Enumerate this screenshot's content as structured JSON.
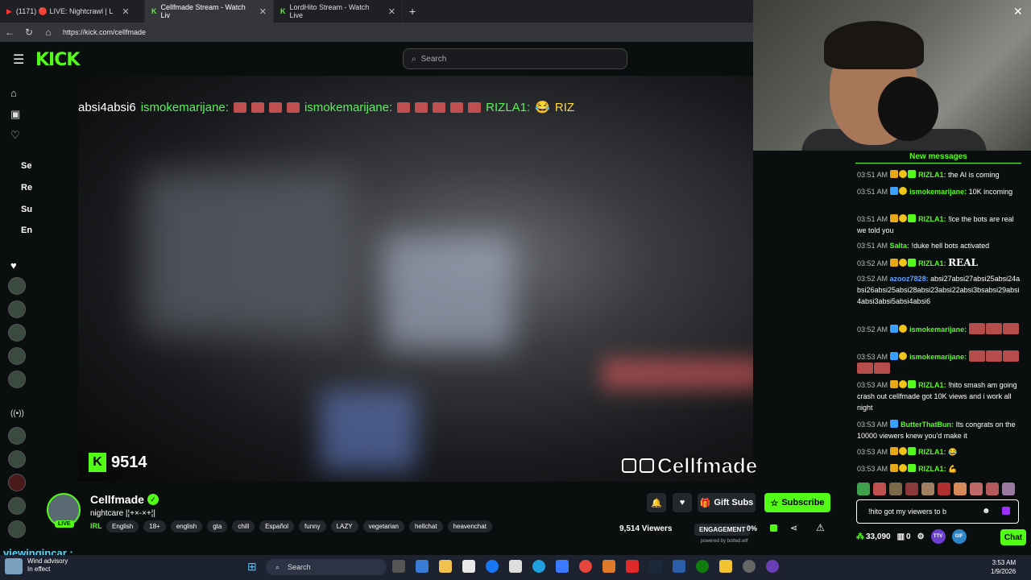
{
  "browser": {
    "tabs": [
      {
        "label": "(1171) 🔴 LIVE: Nightcrawl | L",
        "active": false
      },
      {
        "label": "Cellfmade Stream - Watch Liv",
        "active": true
      },
      {
        "label": "LordHito Stream - Watch Live",
        "active": false
      }
    ],
    "new_tab": "+",
    "url": "https://kick.com/cellfmade"
  },
  "kick": {
    "logo": "KICK",
    "search_placeholder": "Search",
    "sidebar_labels": [
      "Se",
      "Re",
      "Su",
      "En"
    ]
  },
  "video": {
    "overlay_chat": "absi4absi6",
    "overlay_user1": "ismokemarijane:",
    "overlay_user2": "ismokemarijane:",
    "overlay_user3": "RIZLA1:",
    "overlay_tail": "RIZ",
    "overlay_viewers": "9514",
    "overlay_brand": "Cellfmade"
  },
  "stream": {
    "channel": "Cellfmade",
    "title": "nightcare |¦+×-×+¦|",
    "category": "IRL",
    "live": "LIVE",
    "tags": [
      "English",
      "18+",
      "english",
      "gta",
      "chill",
      "Español",
      "funny",
      "LAZY",
      "vegetarian",
      "hellchat",
      "heavenchat"
    ],
    "gift_subs": "Gift Subs",
    "subscribe": "Subscribe",
    "viewers": "9,514 Viewers",
    "engagement": "ENGAGEMENT",
    "engagement_pct": "0%",
    "powered": "powered by botted.wtf"
  },
  "bottom_name": "viewingincar :",
  "chat": {
    "header": "New messages",
    "messages": [
      {
        "time": "03:51 AM",
        "user": "RIZLA1:",
        "text": "the AI is coming",
        "color": "#53fc18"
      },
      {
        "time": "03:51 AM",
        "user": "ismokemarijane:",
        "text": "10K incoming",
        "color": "#53fc18"
      },
      {
        "time": "03:51 AM",
        "user": "RIZLA1:",
        "text": "!lce the bots are real we told you",
        "color": "#53fc18"
      },
      {
        "time": "03:51 AM",
        "user": "Salta:",
        "text": "!duke hell bots activated",
        "color": "#53fc18"
      },
      {
        "time": "03:52 AM",
        "user": "RIZLA1:",
        "text": "REAL",
        "color": "#53fc18"
      },
      {
        "time": "03:52 AM",
        "user": "azooz7828:",
        "text": "absi27absi27absi25absi24absi26absi25absi28absi23absi22absi3bsabsi29absi4absi3absi5absi4absi6",
        "color": "#5aa3ff"
      },
      {
        "time": "03:52 AM",
        "user": "ismokemarijane:",
        "text": "",
        "color": "#53fc18"
      },
      {
        "time": "03:53 AM",
        "user": "ismokemarijane:",
        "text": "",
        "color": "#53fc18"
      },
      {
        "time": "03:53 AM",
        "user": "RIZLA1:",
        "text": "!hito smash am going crash out cellfmade got 10K views and i work all night",
        "color": "#53fc18"
      },
      {
        "time": "03:53 AM",
        "user": "ButterThatBun:",
        "text": "Its congrats on the 10000 viewers knew you'd make it",
        "color": "#53fc18"
      },
      {
        "time": "03:53 AM",
        "user": "RIZLA1:",
        "text": "",
        "color": "#53fc18"
      },
      {
        "time": "03:53 AM",
        "user": "RIZLA1:",
        "text": "",
        "color": "#53fc18"
      }
    ],
    "input_value": "!hito got my viewers to b",
    "points": "33,090",
    "zero": "0",
    "chat_button": "Chat",
    "badge_ttv": "TTV",
    "badge_gif": "GIF"
  },
  "taskbar": {
    "weather_title": "Wind advisory",
    "weather_sub": "In effect",
    "search": "Search",
    "time": "3:53 AM",
    "date": "1/9/2026"
  }
}
